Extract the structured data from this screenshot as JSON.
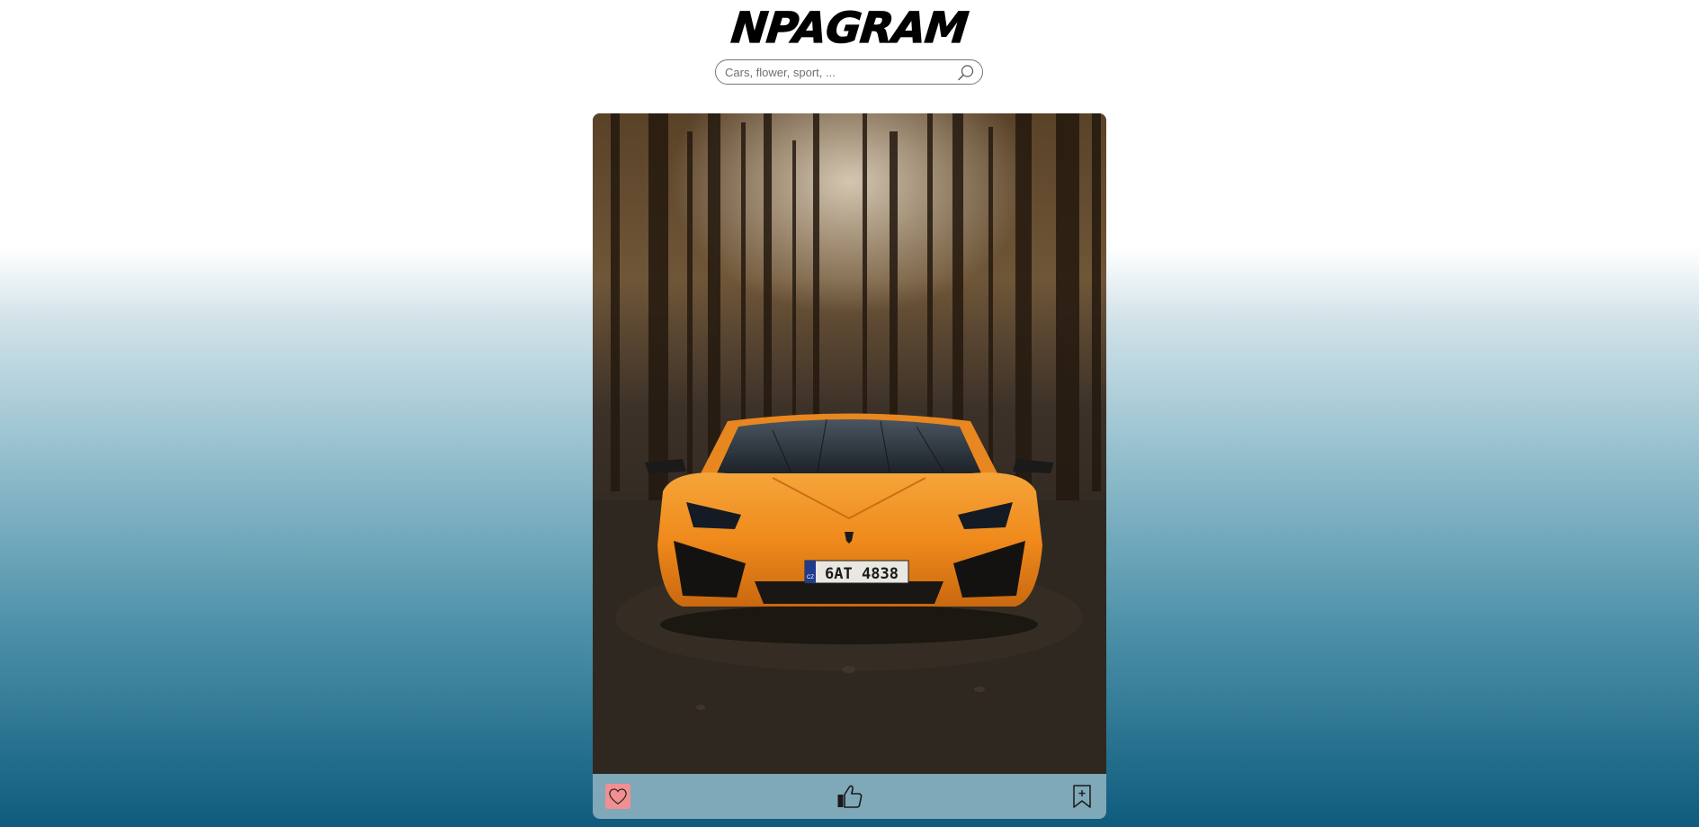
{
  "header": {
    "logo_text": "NPAGRAM"
  },
  "search": {
    "placeholder": "Cars, flower, sport, ...",
    "value": "",
    "icon": "search-icon"
  },
  "post": {
    "image_description_icon": "car-photo",
    "plate_text": "6AT 4838",
    "plate_country": "CZ",
    "actions": [
      {
        "name": "favorite",
        "icon": "heart-icon",
        "active": true
      },
      {
        "name": "like",
        "icon": "thumbs-up-icon",
        "active": false
      },
      {
        "name": "save",
        "icon": "bookmark-add-icon",
        "active": false
      }
    ]
  },
  "colors": {
    "gradient_bottom": "#0e5b7d",
    "action_bar": "#7fa8b8",
    "heart_active_bg": "#f28f93",
    "car_orange": "#f28a1f"
  }
}
